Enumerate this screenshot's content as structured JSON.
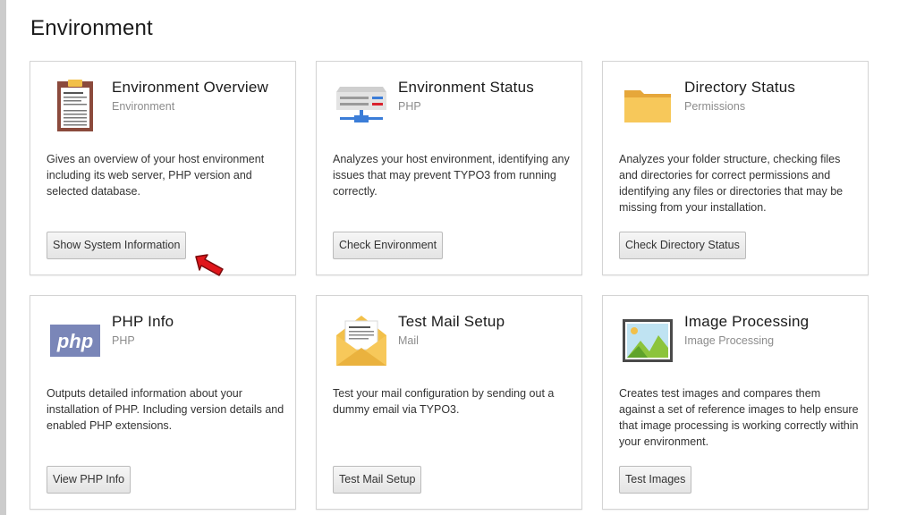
{
  "page": {
    "title": "Environment"
  },
  "cards": [
    {
      "title": "Environment Overview",
      "subtitle": "Environment",
      "description": "Gives an overview of your host environment including its web server, PHP version and selected database.",
      "button": "Show System Information",
      "icon": "clipboard-icon"
    },
    {
      "title": "Environment Status",
      "subtitle": "PHP",
      "description": "Analyzes your host environment, identifying any issues that may prevent TYPO3 from running correctly.",
      "button": "Check Environment",
      "icon": "server-icon"
    },
    {
      "title": "Directory Status",
      "subtitle": "Permissions",
      "description": "Analyzes your folder structure, checking files and directories for correct permissions and identifying any files or directories that may be missing from your installation.",
      "button": "Check Directory Status",
      "icon": "folder-icon"
    },
    {
      "title": "PHP Info",
      "subtitle": "PHP",
      "description": "Outputs detailed information about your installation of PHP. Including version details and enabled PHP extensions.",
      "button": "View PHP Info",
      "icon": "php-logo-icon",
      "icon_text": "php"
    },
    {
      "title": "Test Mail Setup",
      "subtitle": "Mail",
      "description": "Test your mail configuration by sending out a dummy email via TYPO3.",
      "button": "Test Mail Setup",
      "icon": "mail-envelope-icon"
    },
    {
      "title": "Image Processing",
      "subtitle": "Image Processing",
      "description": "Creates test images and compares them against a set of reference images to help ensure that image processing is working correctly within your environment.",
      "button": "Test Images",
      "icon": "landscape-image-icon"
    }
  ],
  "colors": {
    "php_logo": "#7a86b8",
    "folder": "#f7c85a",
    "clipboard": "#8b4a3c",
    "cursor": "#e0161b"
  }
}
